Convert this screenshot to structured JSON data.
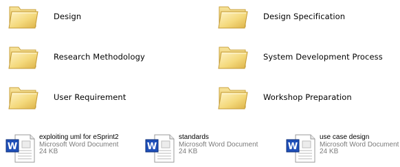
{
  "folders": [
    {
      "label": "Design"
    },
    {
      "label": "Design Specification"
    },
    {
      "label": "Research Methodology"
    },
    {
      "label": "System Development Process"
    },
    {
      "label": "User Requirement"
    },
    {
      "label": "Workshop Preparation"
    }
  ],
  "documents": [
    {
      "name": "exploiting uml for eSprint2",
      "type": "Microsoft Word Document",
      "size": "24 KB"
    },
    {
      "name": "standards",
      "type": "Microsoft Word Document",
      "size": "24 KB"
    },
    {
      "name": "use case design",
      "type": "Microsoft Word Document",
      "size": "24 KB"
    }
  ],
  "icons": {
    "folder": "folder-icon",
    "document": "word-document-icon"
  },
  "colors": {
    "folder_body": "#f2d77a",
    "folder_edge": "#c9a23c",
    "word_blue": "#1f4fb8"
  }
}
